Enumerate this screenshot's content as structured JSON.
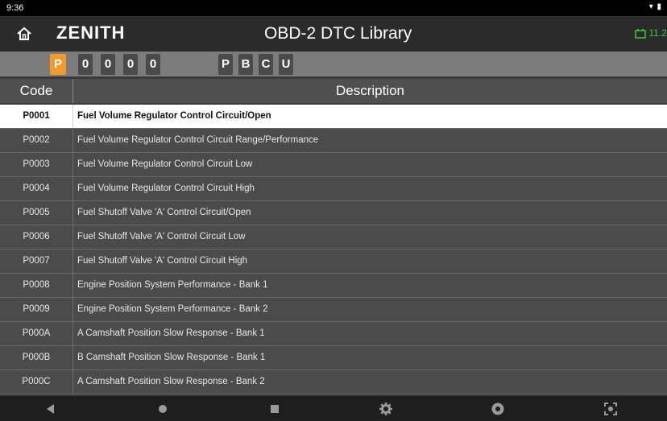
{
  "status_bar": {
    "time": "9:36",
    "system_icons": "wifi battery"
  },
  "app": {
    "brand": "ZENITH",
    "title": "OBD-2 DTC Library",
    "battery_text": "11.2"
  },
  "filter": {
    "digits": [
      "P",
      "0",
      "0",
      "0",
      "0"
    ],
    "systems": [
      "P",
      "B",
      "C",
      "U"
    ]
  },
  "table": {
    "columns": [
      "Code",
      "Description"
    ],
    "rows": [
      {
        "code": "P0001",
        "description": "Fuel Volume Regulator Control Circuit/Open"
      },
      {
        "code": "P0002",
        "description": "Fuel Volume Regulator Control Circuit Range/Performance"
      },
      {
        "code": "P0003",
        "description": "Fuel Volume Regulator Control Circuit Low"
      },
      {
        "code": "P0004",
        "description": "Fuel Volume Regulator Control Circuit High"
      },
      {
        "code": "P0005",
        "description": "Fuel Shutoff Valve 'A' Control Circuit/Open"
      },
      {
        "code": "P0006",
        "description": "Fuel Shutoff Valve 'A' Control Circuit Low"
      },
      {
        "code": "P0007",
        "description": "Fuel Shutoff Valve 'A' Control Circuit High"
      },
      {
        "code": "P0008",
        "description": "Engine Position System Performance - Bank 1"
      },
      {
        "code": "P0009",
        "description": "Engine Position System Performance - Bank 2"
      },
      {
        "code": "P000A",
        "description": "A Camshaft Position Slow Response - Bank 1"
      },
      {
        "code": "P000B",
        "description": "B Camshaft Position Slow Response - Bank 1"
      },
      {
        "code": "P000C",
        "description": "A Camshaft Position Slow Response - Bank 2"
      }
    ],
    "selected_index": 0
  },
  "nav_bar": {
    "icons": [
      "back-icon",
      "home-icon",
      "recents-icon",
      "settings-icon",
      "chrome-icon",
      "screenshot-icon"
    ]
  },
  "colors": {
    "accent": "#f39a2c",
    "battery": "#3ec43e",
    "selected_row": "#ffffff"
  }
}
